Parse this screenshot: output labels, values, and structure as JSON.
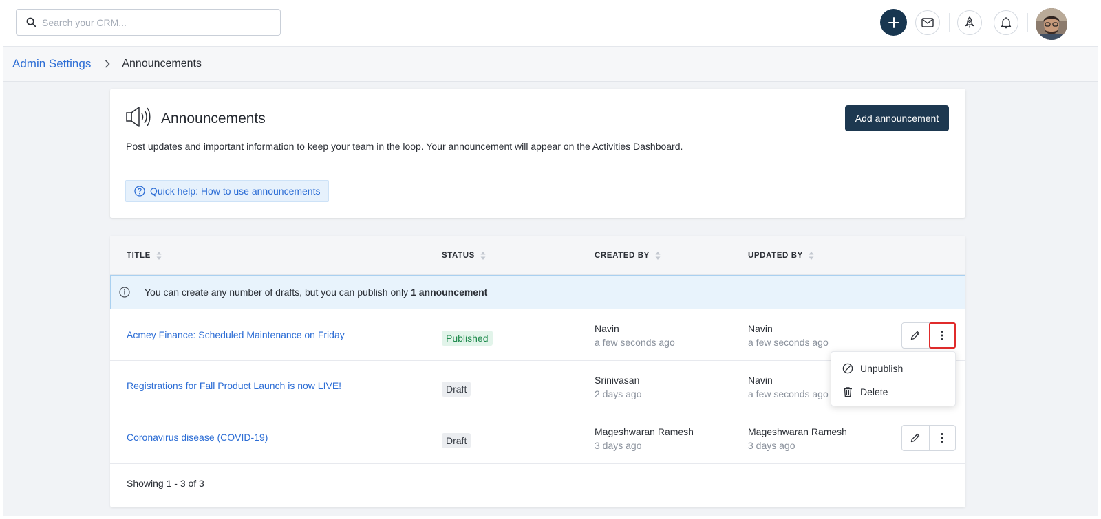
{
  "search": {
    "placeholder": "Search your CRM..."
  },
  "topbar": {
    "icons": [
      "plus-icon",
      "mail-icon",
      "rocket-icon",
      "bell-icon"
    ],
    "accent": "#183650"
  },
  "breadcrumb": {
    "parent": "Admin Settings",
    "current": "Announcements"
  },
  "header": {
    "title": "Announcements",
    "description": "Post updates and important information to keep your team in the loop. Your announcement will appear on the Activities Dashboard.",
    "help_label": "Quick help: How to use announcements",
    "add_button": "Add announcement"
  },
  "table": {
    "columns": [
      "TITLE",
      "STATUS",
      "CREATED BY",
      "UPDATED BY"
    ],
    "info_prefix": "You can create any number of drafts, but you can publish only",
    "info_bold": "1 announcement",
    "rows": [
      {
        "title": "Acmey Finance: Scheduled Maintenance on Friday",
        "status": "Published",
        "created_by": "Navin",
        "created_when": "a few seconds ago",
        "updated_by": "Navin",
        "updated_when": "a few seconds ago"
      },
      {
        "title": "Registrations for Fall Product Launch is now LIVE!",
        "status": "Draft",
        "created_by": "Srinivasan",
        "created_when": "2 days ago",
        "updated_by": "Navin",
        "updated_when": "a few seconds ago"
      },
      {
        "title": "Coronavirus disease (COVID-19)",
        "status": "Draft",
        "created_by": "Mageshwaran Ramesh",
        "created_when": "3 days ago",
        "updated_by": "Mageshwaran Ramesh",
        "updated_when": "3 days ago"
      }
    ],
    "footer": "Showing 1 - 3 of 3"
  },
  "menu": {
    "unpublish": "Unpublish",
    "delete": "Delete"
  },
  "colors": {
    "link": "#2c6dd5",
    "published_bg": "#e2f4ea",
    "published_text": "#1e8a4c",
    "draft_bg": "#ebedf0",
    "highlight": "#e02b2b"
  }
}
